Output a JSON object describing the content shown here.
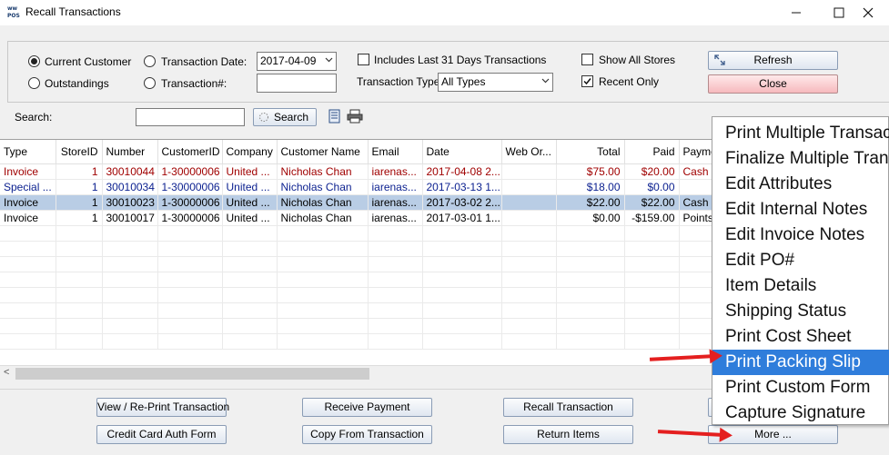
{
  "window": {
    "title": "Recall Transactions",
    "app_icon_text": "WW POS",
    "minimize_label": "—",
    "maximize_label": "☐",
    "close_label": "✕"
  },
  "filters": {
    "current_customer": "Current Customer",
    "outstandings": "Outstandings",
    "transaction_date_label": "Transaction Date:",
    "transaction_date_value": "2017-04-09",
    "transaction_no_label": "Transaction#:",
    "transaction_no_value": "",
    "includes_last_31": "Includes Last 31 Days Transactions",
    "transaction_type_label": "Transaction Type:",
    "transaction_type_value": "All Types",
    "show_all_stores": "Show All Stores",
    "recent_only": "Recent Only",
    "selected_radio": "current_customer",
    "recent_only_checked": true,
    "show_all_stores_checked": false,
    "includes_last_31_checked": false
  },
  "buttons": {
    "refresh": "Refresh",
    "close": "Close",
    "search": "Search",
    "view_reprint": "View / Re-Print Transaction",
    "credit_card_auth": "Credit Card Auth Form",
    "receive_payment": "Receive Payment",
    "copy_from_transaction": "Copy From Transaction",
    "recall_transaction": "Recall Transaction",
    "return_items": "Return Items",
    "more": "More ..."
  },
  "search": {
    "label": "Search:",
    "value": ""
  },
  "grid": {
    "columns": [
      "Type",
      "StoreID",
      "Number",
      "CustomerID",
      "Company",
      "Customer Name",
      "Email",
      "Date",
      "Web Or...",
      "Total",
      "Paid",
      "Payme"
    ],
    "rows": [
      {
        "cells": [
          "Invoice",
          "1",
          "30010044",
          "1-30000006",
          "United ...",
          "Nicholas Chan",
          "iarenas...",
          "2017-04-08 2...",
          "",
          "$75.00",
          "$20.00",
          "Cash"
        ],
        "color": "#a00000",
        "selected": false
      },
      {
        "cells": [
          "Special ...",
          "1",
          "30010034",
          "1-30000006",
          "United ...",
          "Nicholas Chan",
          "iarenas...",
          "2017-03-13 1...",
          "",
          "$18.00",
          "$0.00",
          ""
        ],
        "color": "#0a1f8f",
        "selected": false
      },
      {
        "cells": [
          "Invoice",
          "1",
          "30010023",
          "1-30000006",
          "United ...",
          "Nicholas Chan",
          "iarenas...",
          "2017-03-02 2...",
          "",
          "$22.00",
          "$22.00",
          "Cash"
        ],
        "color": "#000000",
        "selected": true
      },
      {
        "cells": [
          "Invoice",
          "1",
          "30010017",
          "1-30000006",
          "United ...",
          "Nicholas Chan",
          "iarenas...",
          "2017-03-01 1...",
          "",
          "$0.00",
          "-$159.00",
          "Points"
        ],
        "color": "#000000",
        "selected": false
      }
    ],
    "scroll_left_glyph": "<"
  },
  "context_menu": {
    "items": [
      {
        "label": "Print Multiple Transactions",
        "highlighted": false
      },
      {
        "label": "Finalize Multiple Transactions",
        "highlighted": false
      },
      {
        "label": "Edit Attributes",
        "highlighted": false
      },
      {
        "label": "Edit Internal Notes",
        "highlighted": false
      },
      {
        "label": "Edit Invoice Notes",
        "highlighted": false
      },
      {
        "label": "Edit PO#",
        "highlighted": false
      },
      {
        "label": "Item Details",
        "highlighted": false
      },
      {
        "label": "Shipping Status",
        "highlighted": false
      },
      {
        "label": "Print Cost Sheet",
        "highlighted": false
      },
      {
        "label": "Print Packing Slip",
        "highlighted": true
      },
      {
        "label": "Print Custom Form",
        "highlighted": false
      },
      {
        "label": "Capture Signature",
        "highlighted": false
      }
    ],
    "highlight_color": "#2f7ddb"
  },
  "icons": {
    "dropdown": "chevron-down-icon",
    "refresh": "refresh-icon",
    "search": "search-icon",
    "notes": "notes-icon",
    "printer": "printer-icon"
  },
  "annotation_color": "#e41f1f"
}
